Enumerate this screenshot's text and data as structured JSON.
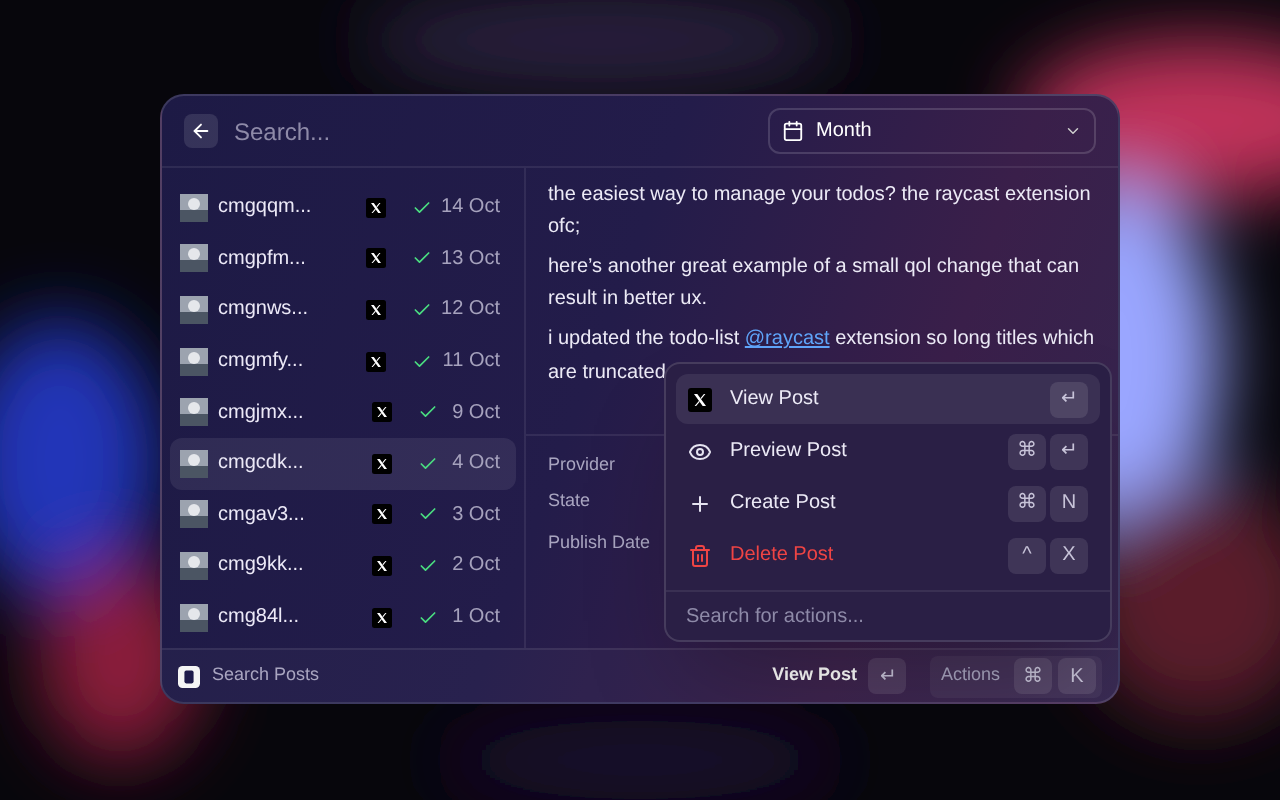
{
  "search": {
    "placeholder": "Search..."
  },
  "filter": {
    "label": "Month"
  },
  "posts": [
    {
      "title": "cmgqqm...",
      "date": "14 Oct",
      "selected": false
    },
    {
      "title": "cmgpfm...",
      "date": "13 Oct",
      "selected": false
    },
    {
      "title": "cmgnws...",
      "date": "12 Oct",
      "selected": false
    },
    {
      "title": "cmgmfy...",
      "date": "11 Oct",
      "selected": false
    },
    {
      "title": "cmgjmx...",
      "date": "9 Oct",
      "selected": false
    },
    {
      "title": "cmgcdk...",
      "date": "4 Oct",
      "selected": true
    },
    {
      "title": "cmgav3...",
      "date": "3 Oct",
      "selected": false
    },
    {
      "title": "cmg9kk...",
      "date": "2 Oct",
      "selected": false
    },
    {
      "title": "cmg84l...",
      "date": "1 Oct",
      "selected": false
    }
  ],
  "detail": {
    "paragraphs": [
      "the easiest way to manage your todos? the raycast extension ofc;",
      "here’s another great example of a small qol change that can result in better ux."
    ],
    "mention_line": {
      "before": "i updated the todo-list ",
      "link": "@raycast",
      "after": " extension so long titles which"
    },
    "cut_line": "are truncated",
    "fields": [
      "Provider",
      "State",
      "Publish Date"
    ]
  },
  "actions": {
    "items": [
      {
        "kind": "x",
        "label": "View Post",
        "keys": [
          "↵"
        ],
        "selected": true,
        "danger": false
      },
      {
        "kind": "eye",
        "label": "Preview Post",
        "keys": [
          "⌘",
          "↵"
        ],
        "selected": false,
        "danger": false
      },
      {
        "kind": "plus",
        "label": "Create Post",
        "keys": [
          "⌘",
          "N"
        ],
        "selected": false,
        "danger": false
      },
      {
        "kind": "trash",
        "label": "Delete Post",
        "keys": [
          "^",
          "X"
        ],
        "selected": false,
        "danger": true
      }
    ],
    "placeholder": "Search for actions..."
  },
  "footer": {
    "title": "Search Posts",
    "primary": "View Post",
    "primary_key": "↵",
    "actions": "Actions",
    "action_keys": [
      "⌘",
      "K"
    ]
  }
}
